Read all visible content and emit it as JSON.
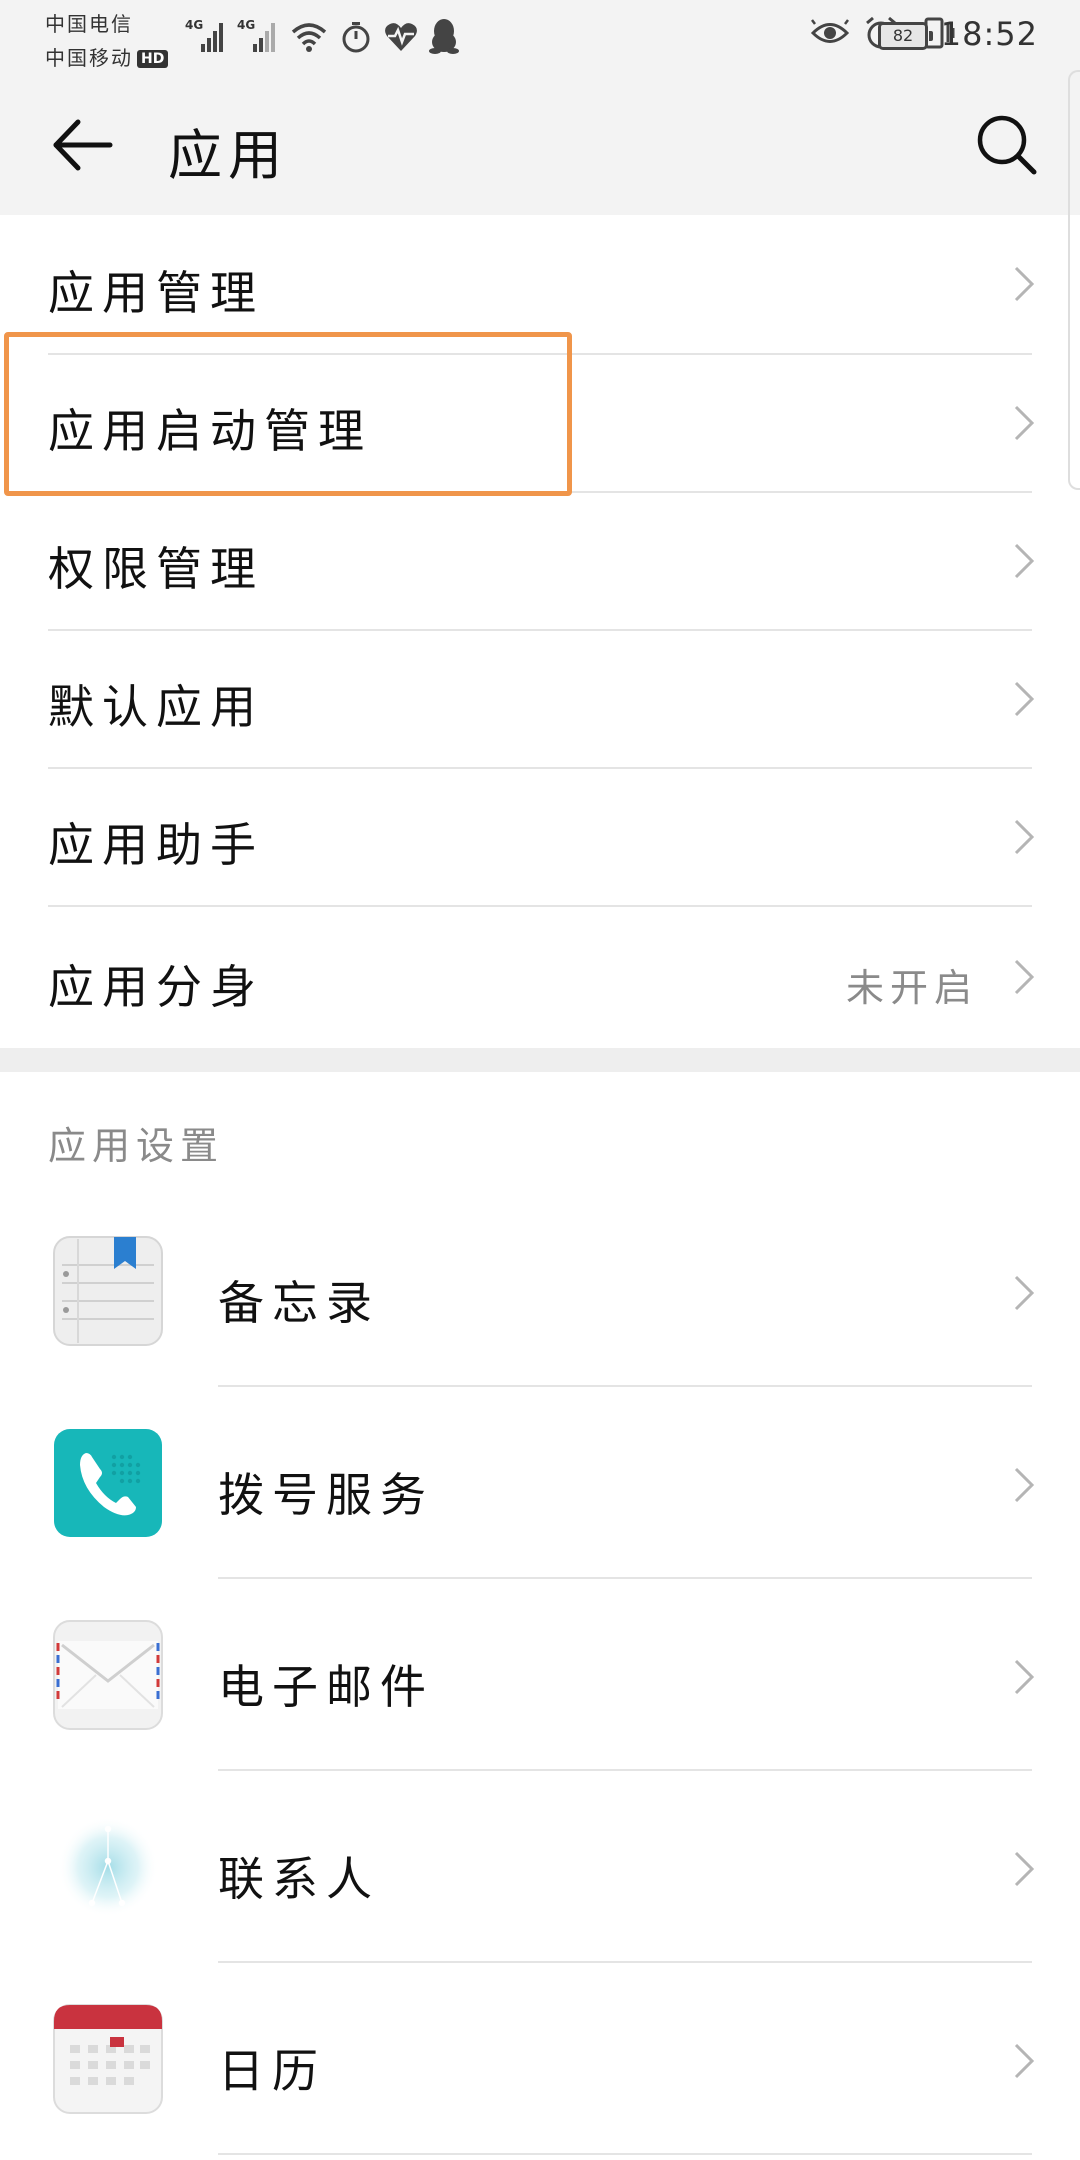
{
  "status_bar": {
    "carrier_1": "中国电信",
    "carrier_2": "中国移动",
    "hd_badge": "HD",
    "signal_1_label": "4G",
    "signal_2_label": "4G",
    "battery_level": "82",
    "time": "18:52"
  },
  "header": {
    "title": "应用"
  },
  "menu": {
    "items": [
      {
        "label": "应用管理"
      },
      {
        "label": "应用启动管理"
      },
      {
        "label": "权限管理"
      },
      {
        "label": "默认应用"
      },
      {
        "label": "应用助手"
      },
      {
        "label": "应用分身",
        "value": "未开启"
      }
    ]
  },
  "app_settings": {
    "section_title": "应用设置",
    "apps": [
      {
        "label": "备忘录",
        "icon": "notepad-icon"
      },
      {
        "label": "拨号服务",
        "icon": "phone-icon"
      },
      {
        "label": "电子邮件",
        "icon": "email-icon"
      },
      {
        "label": "联系人",
        "icon": "contacts-icon"
      },
      {
        "label": "日历",
        "icon": "calendar-icon"
      }
    ]
  },
  "colors": {
    "highlight": "#f0954a",
    "background_bar": "#f3f3f3",
    "phone_teal": "#17b7b9",
    "calendar_red": "#c9333f",
    "notepad_bookmark": "#2b7fd0"
  }
}
